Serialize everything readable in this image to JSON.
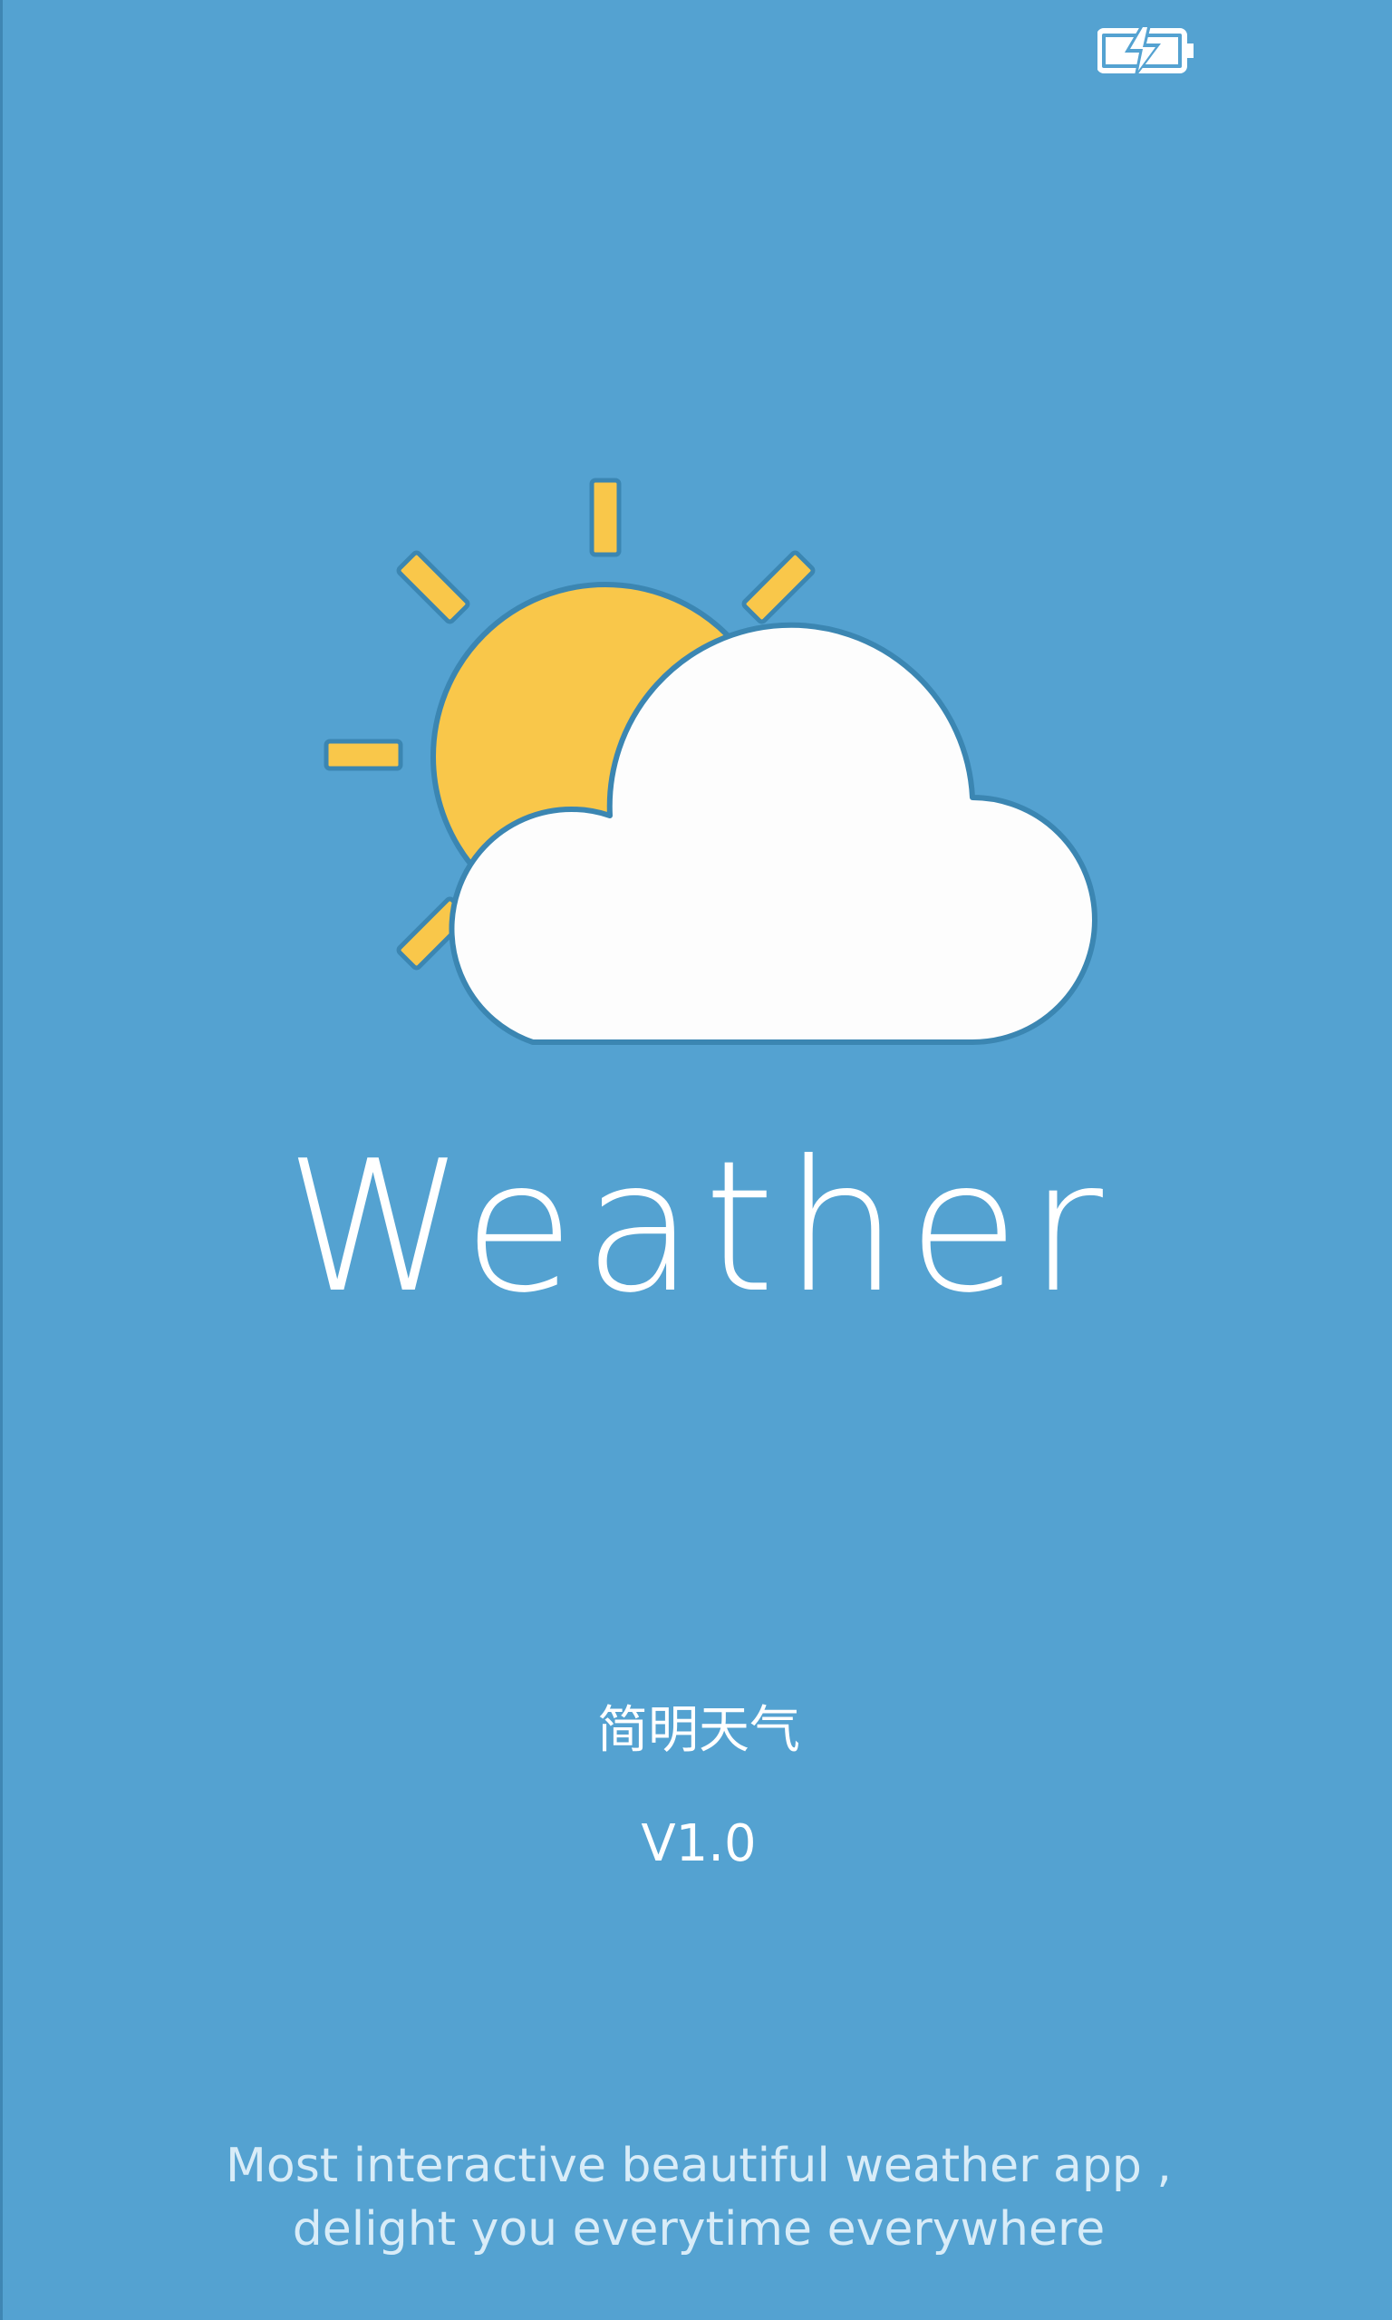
{
  "status_bar": {
    "battery_icon": "battery-charging-icon"
  },
  "splash": {
    "logo_icon": "sun-behind-cloud-icon",
    "wordmark": "Weather",
    "app_name": "简明天气",
    "version": "V1.0",
    "tagline_line1": "Most interactive beautiful weather app ,",
    "tagline_line2": "delight you everytime everywhere"
  },
  "colors": {
    "background": "#54a2d1",
    "sun": "#f9c74a",
    "cloud": "#fdfdfd",
    "outline": "#3b86b2",
    "text": "#ffffff"
  }
}
